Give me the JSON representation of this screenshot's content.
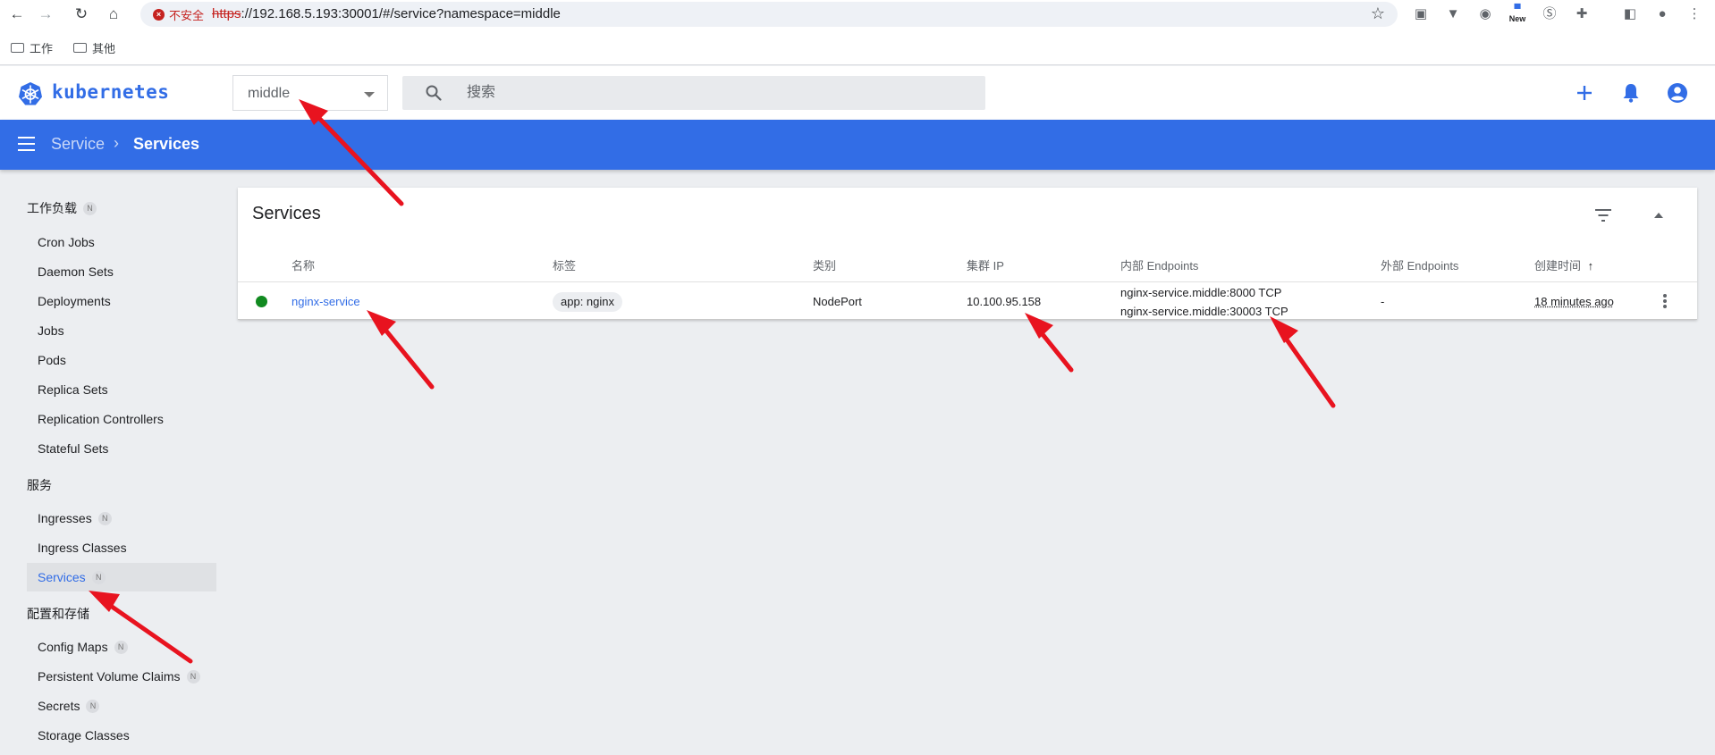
{
  "browser": {
    "security_label": "不安全",
    "url_scheme": "https",
    "url_rest": "://192.168.5.193:30001/#/service?namespace=middle",
    "new_badge": "New",
    "bookmarks": [
      "工作",
      "其他"
    ]
  },
  "app": {
    "brand": "kubernetes",
    "namespace": "middle",
    "search_placeholder": "搜索",
    "accent_color": "#326de6"
  },
  "breadcrumb": {
    "parent": "Service",
    "separator": "›",
    "current": "Services"
  },
  "sidebar": {
    "workloads": {
      "title": "工作负载",
      "badge": "N",
      "items": [
        "Cron Jobs",
        "Daemon Sets",
        "Deployments",
        "Jobs",
        "Pods",
        "Replica Sets",
        "Replication Controllers",
        "Stateful Sets"
      ]
    },
    "services": {
      "title": "服务",
      "items": [
        {
          "label": "Ingresses",
          "badge": "N"
        },
        {
          "label": "Ingress Classes",
          "badge": ""
        },
        {
          "label": "Services",
          "badge": "N",
          "active": true
        }
      ]
    },
    "config": {
      "title": "配置和存储",
      "items": [
        {
          "label": "Config Maps",
          "badge": "N"
        },
        {
          "label": "Persistent Volume Claims",
          "badge": "N"
        },
        {
          "label": "Secrets",
          "badge": "N"
        },
        {
          "label": "Storage Classes",
          "badge": ""
        }
      ]
    }
  },
  "card": {
    "title": "Services",
    "columns": [
      "名称",
      "标签",
      "类别",
      "集群 IP",
      "内部 Endpoints",
      "外部 Endpoints",
      "创建时间"
    ],
    "sort_indicator": "↑",
    "rows": [
      {
        "status_color": "#118a20",
        "name": "nginx-service",
        "label": "app: nginx",
        "type": "NodePort",
        "cluster_ip": "10.100.95.158",
        "internal_endpoint_1": "nginx-service.middle:8000 TCP",
        "internal_endpoint_2": "nginx-service.middle:30003 TCP",
        "external_endpoints": "-",
        "created": "18 minutes ago"
      }
    ]
  },
  "annotation_color": "#e8131f"
}
